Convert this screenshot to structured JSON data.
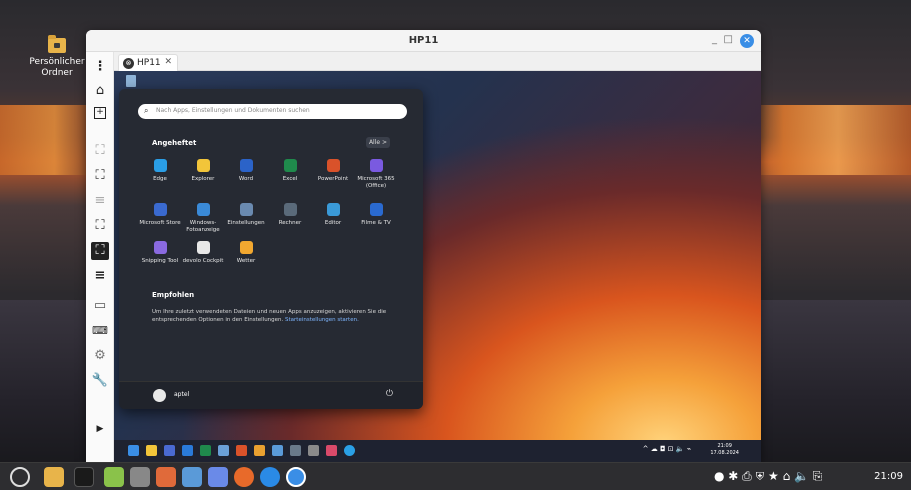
{
  "desktop": {
    "icon_label": "Persönlicher Ordner"
  },
  "window": {
    "title": "HP11",
    "minimize": "_",
    "maximize": "□",
    "close": "✕",
    "tab_label": "HP11",
    "tab_close": "✕"
  },
  "sidebar_icons": [
    "more-icon",
    "home-icon",
    "window-icon",
    "screenshot-icon",
    "fullscreen-icon",
    "list-icon",
    "fit-icon",
    "active-fit-icon",
    "menu-icon",
    "multiwindow-icon",
    "keyboard-icon",
    "settings-icon",
    "wrench-icon",
    "expand-icon"
  ],
  "start_menu": {
    "search_placeholder": "Nach Apps, Einstellungen und Dokumenten suchen",
    "pinned_title": "Angeheftet",
    "all_button": "Alle  >",
    "apps": [
      {
        "label": "Edge",
        "color": "#2a9ee6"
      },
      {
        "label": "Explorer",
        "color": "#f2c53a"
      },
      {
        "label": "Word",
        "color": "#2b63c8"
      },
      {
        "label": "Excel",
        "color": "#1f8a4c"
      },
      {
        "label": "PowerPoint",
        "color": "#d9522a"
      },
      {
        "label": "Microsoft 365 (Office)",
        "color": "#7a5ae0"
      },
      {
        "label": "Microsoft Store",
        "color": "#3a6ad0"
      },
      {
        "label": "Windows-Fotoanzeige",
        "color": "#3a8ad8"
      },
      {
        "label": "Einstellungen",
        "color": "#6a8ab0"
      },
      {
        "label": "Rechner",
        "color": "#5a6a7a"
      },
      {
        "label": "Editor",
        "color": "#3a9ad8"
      },
      {
        "label": "Filme & TV",
        "color": "#2a6ad0"
      },
      {
        "label": "Snipping Tool",
        "color": "#8a6ae0"
      },
      {
        "label": "devolo Cockpit",
        "color": "#e8e8e8"
      },
      {
        "label": "Wetter",
        "color": "#f2a830"
      }
    ],
    "recommended_title": "Empfohlen",
    "recommended_text": "Um Ihre zuletzt verwendeten Dateien und neuen Apps anzuzeigen, aktivieren Sie die entsprechenden Optionen in den Einstellungen.",
    "recommended_link": "Starteinstellungen starten.",
    "user": "aptel",
    "power": "⏻"
  },
  "remote_taskbar": {
    "tray": "^ ☁ ◘ ⊡ 🔈 ⌁",
    "time": "21:09",
    "date": "17.08.2024"
  },
  "host_taskbar": {
    "tray": "● ✱ ⎙ ⛨ ★ ⌂ 🔈 ⎘",
    "clock": "21:09"
  }
}
